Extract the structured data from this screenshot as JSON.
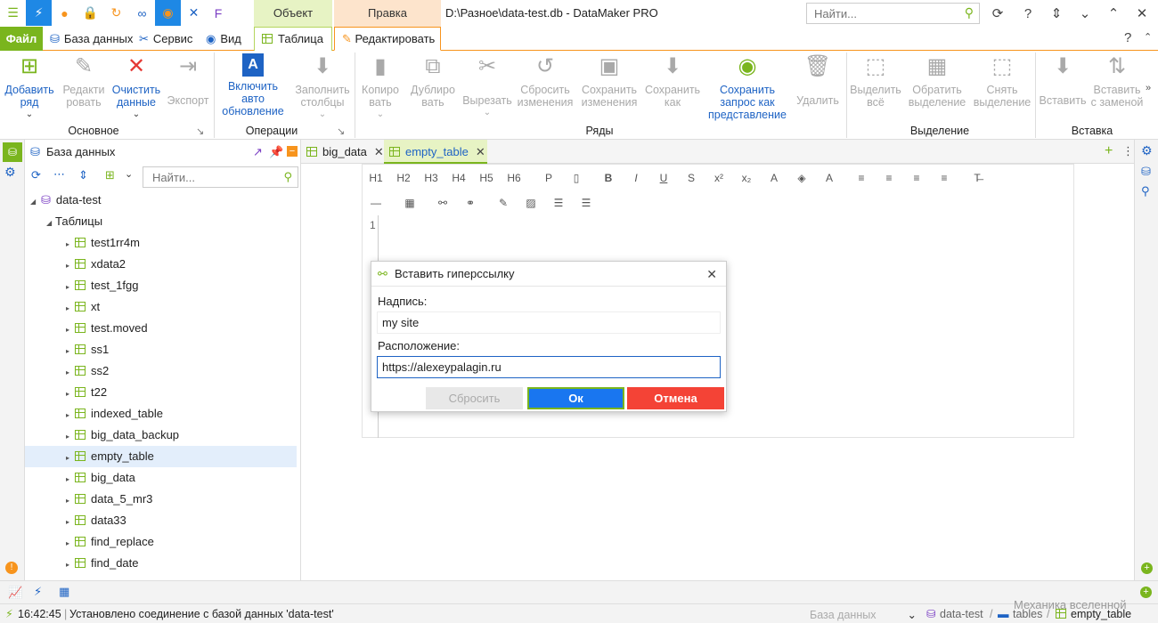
{
  "window": {
    "title": "D:\\Разное\\data-test.db - DataMaker PRO",
    "search_placeholder": "Найти...",
    "context_object": "Объект",
    "context_edit": "Правка"
  },
  "menu": {
    "file": "Файл",
    "database": "База данных",
    "service": "Сервис",
    "view": "Вид",
    "table": "Таблица",
    "edit": "Редактировать"
  },
  "ribbon": {
    "groups": {
      "basic": "Основное",
      "operations": "Операции",
      "rows": "Ряды",
      "selection": "Выделение",
      "insert": "Вставка"
    },
    "add_row": "Добавить ряд",
    "edit_row": "Редакти ровать",
    "clear_data": "Очистить данные",
    "export": "Экспорт",
    "auto_update": "Включить авто обновление",
    "fill_columns": "Заполнить столбцы",
    "copy": "Копиро вать",
    "duplicate": "Дублиро вать",
    "cut": "Вырезать",
    "reset_changes": "Сбросить изменения",
    "save_changes": "Сохранить изменения",
    "save_as": "Сохранить как",
    "save_query_view": "Сохранить запрос как представление",
    "delete": "Удалить",
    "select_all": "Выделить всё",
    "invert_selection": "Обратить выделение",
    "deselect": "Снять выделение",
    "paste": "Вставить",
    "paste_replace": "Вставить с заменой"
  },
  "db_panel": {
    "title": "База данных",
    "search_placeholder": "Найти...",
    "root": "data-test",
    "tables_folder": "Таблицы",
    "tables": [
      "test1rr4m",
      "xdata2",
      "test_1fgg",
      "xt",
      "test.moved",
      "ss1",
      "ss2",
      "t22",
      "indexed_table",
      "big_data_backup",
      "empty_table",
      "big_data",
      "data_5_mr3",
      "data33",
      "find_replace",
      "find_date"
    ],
    "selected": "empty_table"
  },
  "doc_tabs": [
    "big_data",
    "empty_table"
  ],
  "editor": {
    "toolbar_row1": [
      "H1",
      "H2",
      "H3",
      "H4",
      "H5",
      "H6"
    ],
    "line_number": "1"
  },
  "dialog": {
    "title": "Вставить гиперссылку",
    "caption_label": "Надпись:",
    "caption_value": "my site",
    "location_label": "Расположение:",
    "location_value": "https://alexeypalagin.ru",
    "reset": "Сбросить",
    "ok": "Ок",
    "cancel": "Отмена"
  },
  "status": {
    "time": "16:42:45",
    "message": "Установлено соединение с базой данных 'data-test'",
    "db_selector": "База данных",
    "breadcrumb_db": "data-test",
    "breadcrumb_tables": "tables",
    "breadcrumb_table": "empty_table",
    "watermark": "Механика вселенной"
  },
  "colors": {
    "accent_green": "#7ab51d",
    "accent_orange": "#f7941d",
    "blue": "#1e88e5",
    "ok_blue": "#1976f0",
    "cancel_red": "#f44336"
  }
}
